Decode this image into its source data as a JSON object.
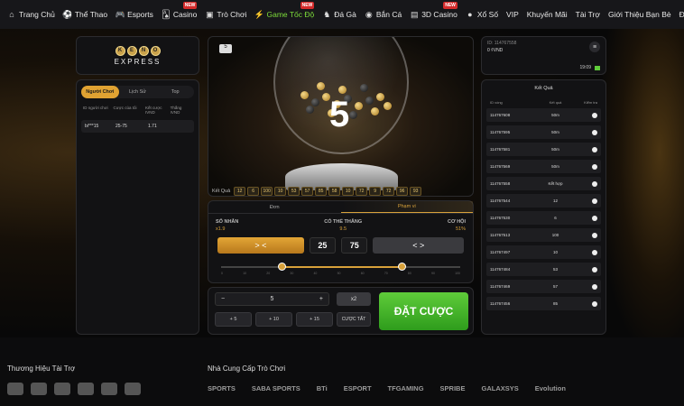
{
  "nav": [
    {
      "label": "Trang Chủ",
      "icon": "home-icon",
      "glyph": "⌂",
      "new": ""
    },
    {
      "label": "Thể Thao",
      "icon": "soccer-ball-icon",
      "glyph": "⚽",
      "new": ""
    },
    {
      "label": "Esports",
      "icon": "gamepad-icon",
      "glyph": "🎮",
      "new": ""
    },
    {
      "label": "Casino",
      "icon": "cards-icon",
      "glyph": "🂡",
      "new": "NEW"
    },
    {
      "label": "Trò Chơi",
      "icon": "slot-icon",
      "glyph": "▣",
      "new": ""
    },
    {
      "label": "Game Tốc Độ",
      "icon": "speed-game-icon",
      "glyph": "⚡",
      "new": "NEW",
      "active": true
    },
    {
      "label": "Đá Gà",
      "icon": "rooster-icon",
      "glyph": "♞",
      "new": ""
    },
    {
      "label": "Bắn Cá",
      "icon": "fish-icon",
      "glyph": "◉",
      "new": ""
    },
    {
      "label": "3D Casino",
      "icon": "3d-cube-icon",
      "glyph": "▤",
      "new": "NEW"
    },
    {
      "label": "Xổ Số",
      "icon": "lottery-icon",
      "glyph": "●",
      "new": ""
    },
    {
      "label": "VIP",
      "icon": "",
      "glyph": "",
      "new": ""
    },
    {
      "label": "Khuyến Mãi",
      "icon": "",
      "glyph": "",
      "new": ""
    },
    {
      "label": "Tài Trợ",
      "icon": "",
      "glyph": "",
      "new": ""
    },
    {
      "label": "Giới Thiệu Bạn Bè",
      "icon": "",
      "glyph": "",
      "new": ""
    },
    {
      "label": "Đại Lý",
      "icon": "",
      "glyph": "",
      "new": ""
    }
  ],
  "logo": {
    "balls": [
      "K",
      "E",
      "N",
      "O"
    ],
    "word": "EXPRESS"
  },
  "left_panel": {
    "tabs": [
      "Người Chơi",
      "Lịch Sử",
      "Top"
    ],
    "headers": [
      "ID người chơi",
      "Cược của tôi",
      "Kết cược\nIVND",
      "Thắng IVND"
    ],
    "row": {
      "player": "bi***15",
      "bet": "25-75",
      "odds": "1.71",
      "win": ""
    }
  },
  "game": {
    "ball_number": "5",
    "cube": "5",
    "results_label": "Kết Quả",
    "results": [
      "12",
      "6",
      "100",
      "10",
      "53",
      "57",
      "85",
      "58",
      "10",
      "72",
      "9",
      "72",
      "96",
      "93"
    ]
  },
  "bet_panel": {
    "modes": [
      "Đơn",
      "Phạm vi"
    ],
    "multiplier_label": "SỐ NHÂN",
    "multiplier": "x1.9",
    "win_label": "CÓ THỂ THẮNG",
    "win": "9.5",
    "chance_label": "CƠ HỘI",
    "chance": "51%",
    "left_arrow": "> <",
    "right_arrow": "< >",
    "from": "25",
    "to": "75",
    "ticks": [
      "0",
      "10",
      "20",
      "30",
      "40",
      "50",
      "60",
      "70",
      "80",
      "90",
      "100"
    ],
    "range_from": 25,
    "range_to": 75
  },
  "amount": {
    "minus": "−",
    "value": "5",
    "plus": "+",
    "x2": "x2",
    "quick": [
      "+ 5",
      "+ 10",
      "+ 15"
    ],
    "clear": "CƯỢC TẤT",
    "place": "ĐẶT CƯỢC"
  },
  "account": {
    "id": "ID: 114767558",
    "balance": "0 ₫VND",
    "time": "19:09"
  },
  "history": {
    "title": "Kết Quả",
    "headers": [
      "ID vòng",
      "Kết quả",
      "Kiểm tra"
    ],
    "rows": [
      [
        "114767608",
        "50m"
      ],
      [
        "114767595",
        "50m"
      ],
      [
        "114767581",
        "50m"
      ],
      [
        "114767569",
        "50m"
      ],
      [
        "114767558",
        "Kết hợp"
      ],
      [
        "114767544",
        "12"
      ],
      [
        "114767530",
        "6"
      ],
      [
        "114767513",
        "100"
      ],
      [
        "114767497",
        "10"
      ],
      [
        "114767484",
        "53"
      ],
      [
        "114767469",
        "57"
      ],
      [
        "114767456",
        "85"
      ]
    ]
  },
  "footer": {
    "sponsor_title": "Thương Hiệu Tài Trợ",
    "provider_title": "Nhà Cung Cấp Trò Chơi",
    "providers": [
      "SPORTS",
      "SABA SPORTS",
      "BTi",
      "ESPORT",
      "TFGAMING",
      "SPRIBE",
      "GALAXSYS",
      "Evolution"
    ]
  }
}
